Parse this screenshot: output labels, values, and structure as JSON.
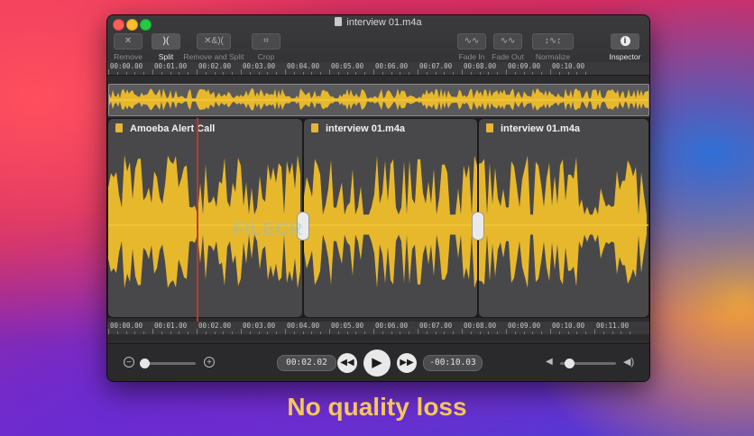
{
  "window": {
    "title": "interview 01.m4a"
  },
  "toolbar": {
    "remove": {
      "icon": "✕",
      "label": "Remove"
    },
    "split": {
      "icon": ")(",
      "label": "Split"
    },
    "remove_and_split": {
      "icon": "✕&)(",
      "label": "Remove and Split"
    },
    "crop": {
      "icon": "⌗",
      "label": "Crop"
    },
    "fade_in": {
      "icon": "∿∿",
      "label": "Fade In"
    },
    "fade_out": {
      "icon": "∿∿",
      "label": "Fade Out"
    },
    "normalize": {
      "icon": "↕∿↕",
      "label": "Normalize"
    },
    "inspector": {
      "icon": "i",
      "label": "Inspector"
    }
  },
  "ruler_top": [
    "00:00.00",
    "00:01.00",
    "00:02.00",
    "00:03.00",
    "00:04.00",
    "00:05.00",
    "00:06.00",
    "00:07.00",
    "00:08.00",
    "00:09.00",
    "00:10.00"
  ],
  "ruler_bottom": [
    "00:00.00",
    "00:01.00",
    "00:02.00",
    "00:03.00",
    "00:04.00",
    "00:05.00",
    "00:06.00",
    "00:07.00",
    "00:08.00",
    "00:09.00",
    "00:10.00",
    "00:11.00"
  ],
  "clips": [
    {
      "name": "Amoeba Alert Call"
    },
    {
      "name": "interview 01.m4a"
    },
    {
      "name": "interview 01.m4a"
    }
  ],
  "transport": {
    "current_time": "00:02.02",
    "remaining_time": "-00:10.03",
    "zoom": 0.05,
    "volume": 0.05
  },
  "watermark": "FILECR",
  "caption": "No quality loss",
  "colors": {
    "waveform": "#e8b82c",
    "accent_caption": "#f5c65c",
    "playhead": "#c0392b"
  }
}
